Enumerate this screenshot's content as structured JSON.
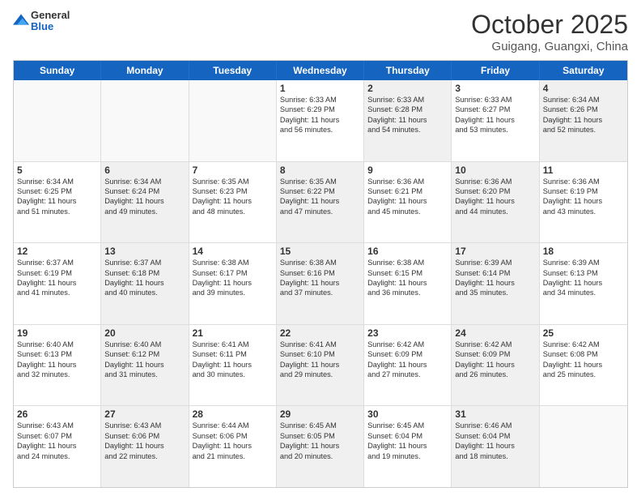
{
  "header": {
    "logo_general": "General",
    "logo_blue": "Blue",
    "title": "October 2025",
    "location": "Guigang, Guangxi, China"
  },
  "weekdays": [
    "Sunday",
    "Monday",
    "Tuesday",
    "Wednesday",
    "Thursday",
    "Friday",
    "Saturday"
  ],
  "rows": [
    [
      {
        "day": "",
        "info": "",
        "shaded": false,
        "empty": true
      },
      {
        "day": "",
        "info": "",
        "shaded": false,
        "empty": true
      },
      {
        "day": "",
        "info": "",
        "shaded": false,
        "empty": true
      },
      {
        "day": "1",
        "info": "Sunrise: 6:33 AM\nSunset: 6:29 PM\nDaylight: 11 hours\nand 56 minutes.",
        "shaded": false,
        "empty": false
      },
      {
        "day": "2",
        "info": "Sunrise: 6:33 AM\nSunset: 6:28 PM\nDaylight: 11 hours\nand 54 minutes.",
        "shaded": true,
        "empty": false
      },
      {
        "day": "3",
        "info": "Sunrise: 6:33 AM\nSunset: 6:27 PM\nDaylight: 11 hours\nand 53 minutes.",
        "shaded": false,
        "empty": false
      },
      {
        "day": "4",
        "info": "Sunrise: 6:34 AM\nSunset: 6:26 PM\nDaylight: 11 hours\nand 52 minutes.",
        "shaded": true,
        "empty": false
      }
    ],
    [
      {
        "day": "5",
        "info": "Sunrise: 6:34 AM\nSunset: 6:25 PM\nDaylight: 11 hours\nand 51 minutes.",
        "shaded": false,
        "empty": false
      },
      {
        "day": "6",
        "info": "Sunrise: 6:34 AM\nSunset: 6:24 PM\nDaylight: 11 hours\nand 49 minutes.",
        "shaded": true,
        "empty": false
      },
      {
        "day": "7",
        "info": "Sunrise: 6:35 AM\nSunset: 6:23 PM\nDaylight: 11 hours\nand 48 minutes.",
        "shaded": false,
        "empty": false
      },
      {
        "day": "8",
        "info": "Sunrise: 6:35 AM\nSunset: 6:22 PM\nDaylight: 11 hours\nand 47 minutes.",
        "shaded": true,
        "empty": false
      },
      {
        "day": "9",
        "info": "Sunrise: 6:36 AM\nSunset: 6:21 PM\nDaylight: 11 hours\nand 45 minutes.",
        "shaded": false,
        "empty": false
      },
      {
        "day": "10",
        "info": "Sunrise: 6:36 AM\nSunset: 6:20 PM\nDaylight: 11 hours\nand 44 minutes.",
        "shaded": true,
        "empty": false
      },
      {
        "day": "11",
        "info": "Sunrise: 6:36 AM\nSunset: 6:19 PM\nDaylight: 11 hours\nand 43 minutes.",
        "shaded": false,
        "empty": false
      }
    ],
    [
      {
        "day": "12",
        "info": "Sunrise: 6:37 AM\nSunset: 6:19 PM\nDaylight: 11 hours\nand 41 minutes.",
        "shaded": false,
        "empty": false
      },
      {
        "day": "13",
        "info": "Sunrise: 6:37 AM\nSunset: 6:18 PM\nDaylight: 11 hours\nand 40 minutes.",
        "shaded": true,
        "empty": false
      },
      {
        "day": "14",
        "info": "Sunrise: 6:38 AM\nSunset: 6:17 PM\nDaylight: 11 hours\nand 39 minutes.",
        "shaded": false,
        "empty": false
      },
      {
        "day": "15",
        "info": "Sunrise: 6:38 AM\nSunset: 6:16 PM\nDaylight: 11 hours\nand 37 minutes.",
        "shaded": true,
        "empty": false
      },
      {
        "day": "16",
        "info": "Sunrise: 6:38 AM\nSunset: 6:15 PM\nDaylight: 11 hours\nand 36 minutes.",
        "shaded": false,
        "empty": false
      },
      {
        "day": "17",
        "info": "Sunrise: 6:39 AM\nSunset: 6:14 PM\nDaylight: 11 hours\nand 35 minutes.",
        "shaded": true,
        "empty": false
      },
      {
        "day": "18",
        "info": "Sunrise: 6:39 AM\nSunset: 6:13 PM\nDaylight: 11 hours\nand 34 minutes.",
        "shaded": false,
        "empty": false
      }
    ],
    [
      {
        "day": "19",
        "info": "Sunrise: 6:40 AM\nSunset: 6:13 PM\nDaylight: 11 hours\nand 32 minutes.",
        "shaded": false,
        "empty": false
      },
      {
        "day": "20",
        "info": "Sunrise: 6:40 AM\nSunset: 6:12 PM\nDaylight: 11 hours\nand 31 minutes.",
        "shaded": true,
        "empty": false
      },
      {
        "day": "21",
        "info": "Sunrise: 6:41 AM\nSunset: 6:11 PM\nDaylight: 11 hours\nand 30 minutes.",
        "shaded": false,
        "empty": false
      },
      {
        "day": "22",
        "info": "Sunrise: 6:41 AM\nSunset: 6:10 PM\nDaylight: 11 hours\nand 29 minutes.",
        "shaded": true,
        "empty": false
      },
      {
        "day": "23",
        "info": "Sunrise: 6:42 AM\nSunset: 6:09 PM\nDaylight: 11 hours\nand 27 minutes.",
        "shaded": false,
        "empty": false
      },
      {
        "day": "24",
        "info": "Sunrise: 6:42 AM\nSunset: 6:09 PM\nDaylight: 11 hours\nand 26 minutes.",
        "shaded": true,
        "empty": false
      },
      {
        "day": "25",
        "info": "Sunrise: 6:42 AM\nSunset: 6:08 PM\nDaylight: 11 hours\nand 25 minutes.",
        "shaded": false,
        "empty": false
      }
    ],
    [
      {
        "day": "26",
        "info": "Sunrise: 6:43 AM\nSunset: 6:07 PM\nDaylight: 11 hours\nand 24 minutes.",
        "shaded": false,
        "empty": false
      },
      {
        "day": "27",
        "info": "Sunrise: 6:43 AM\nSunset: 6:06 PM\nDaylight: 11 hours\nand 22 minutes.",
        "shaded": true,
        "empty": false
      },
      {
        "day": "28",
        "info": "Sunrise: 6:44 AM\nSunset: 6:06 PM\nDaylight: 11 hours\nand 21 minutes.",
        "shaded": false,
        "empty": false
      },
      {
        "day": "29",
        "info": "Sunrise: 6:45 AM\nSunset: 6:05 PM\nDaylight: 11 hours\nand 20 minutes.",
        "shaded": true,
        "empty": false
      },
      {
        "day": "30",
        "info": "Sunrise: 6:45 AM\nSunset: 6:04 PM\nDaylight: 11 hours\nand 19 minutes.",
        "shaded": false,
        "empty": false
      },
      {
        "day": "31",
        "info": "Sunrise: 6:46 AM\nSunset: 6:04 PM\nDaylight: 11 hours\nand 18 minutes.",
        "shaded": true,
        "empty": false
      },
      {
        "day": "",
        "info": "",
        "shaded": false,
        "empty": true
      }
    ]
  ]
}
